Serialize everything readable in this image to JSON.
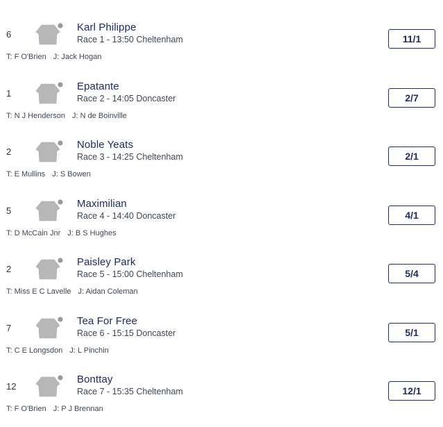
{
  "runners": [
    {
      "number": "6",
      "name": "Karl Philippe",
      "race": "Race 1 - 13:50 Cheltenham",
      "trainer_label": "T:",
      "trainer": "F O'Brien",
      "jockey_label": "J:",
      "jockey": "Jack Hogan",
      "odds": "11/1"
    },
    {
      "number": "1",
      "name": "Epatante",
      "race": "Race 2 - 14:05 Doncaster",
      "trainer_label": "T:",
      "trainer": "N J Henderson",
      "jockey_label": "J:",
      "jockey": "N de Boinville",
      "odds": "2/7"
    },
    {
      "number": "2",
      "name": "Noble Yeats",
      "race": "Race 3 - 14:25 Cheltenham",
      "trainer_label": "T:",
      "trainer": "E Mullins",
      "jockey_label": "J:",
      "jockey": "S Bowen",
      "odds": "2/1"
    },
    {
      "number": "5",
      "name": "Maximilian",
      "race": "Race 4 - 14:40 Doncaster",
      "trainer_label": "T:",
      "trainer": "D McCain Jnr",
      "jockey_label": "J:",
      "jockey": "B S Hughes",
      "odds": "4/1"
    },
    {
      "number": "2",
      "name": "Paisley Park",
      "race": "Race 5 - 15:00 Cheltenham",
      "trainer_label": "T:",
      "trainer": "Miss E C Lavelle",
      "jockey_label": "J:",
      "jockey": "Aidan Coleman",
      "odds": "5/4"
    },
    {
      "number": "7",
      "name": "Tea For Free",
      "race": "Race 6 - 15:15 Doncaster",
      "trainer_label": "T:",
      "trainer": "C E Longsdon",
      "jockey_label": "J:",
      "jockey": "L Pinchin",
      "odds": "5/1"
    },
    {
      "number": "12",
      "name": "Bonttay",
      "race": "Race 7 - 15:35 Cheltenham",
      "trainer_label": "T:",
      "trainer": "F O'Brien",
      "jockey_label": "J:",
      "jockey": "P J Brennan",
      "odds": "12/1"
    }
  ],
  "silk_icon": "jockey-silk-icon",
  "colors": {
    "brand_navy": "#1e2a6b",
    "silk_grey": "#b7b7b7",
    "text_grey": "#3f4757"
  }
}
